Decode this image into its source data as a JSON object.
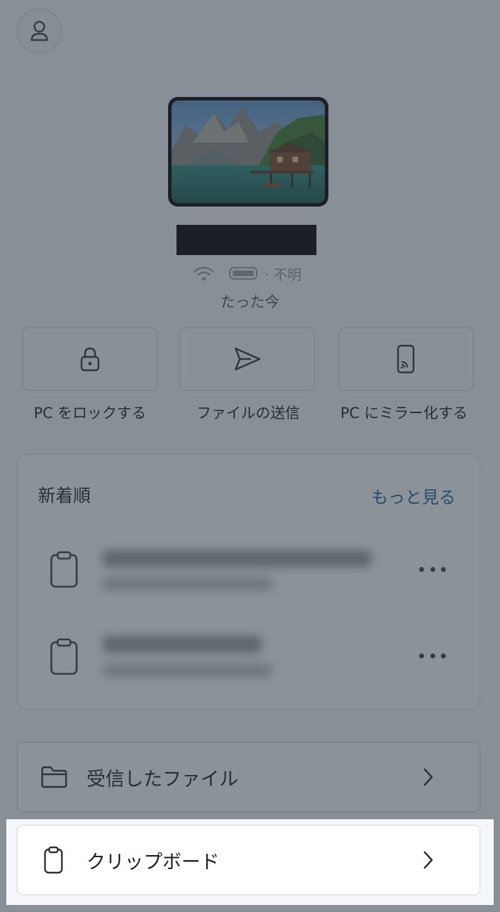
{
  "header": {
    "avatar_icon": "person-icon"
  },
  "device": {
    "name": "",
    "wifi_icon": "wifi-icon",
    "battery_icon": "battery-icon",
    "battery_status": "· 不明",
    "last_seen": "たった今"
  },
  "quick_actions": [
    {
      "label": "PC をロックする",
      "icon": "lock-icon"
    },
    {
      "label": "ファイルの送信",
      "icon": "send-icon"
    },
    {
      "label": "PC にミラー化する",
      "icon": "cast-phone-icon"
    }
  ],
  "recent": {
    "title": "新着順",
    "more_label": "もっと見る",
    "items": [
      {
        "icon": "clipboard-icon",
        "more_icon": "more-icon"
      },
      {
        "icon": "clipboard-icon",
        "more_icon": "more-icon"
      }
    ]
  },
  "nav": {
    "received_files": "受信したファイル",
    "clipboard": "クリップボード"
  },
  "colors": {
    "accent_link": "#1b5fa6",
    "overlay": "#303a46"
  }
}
